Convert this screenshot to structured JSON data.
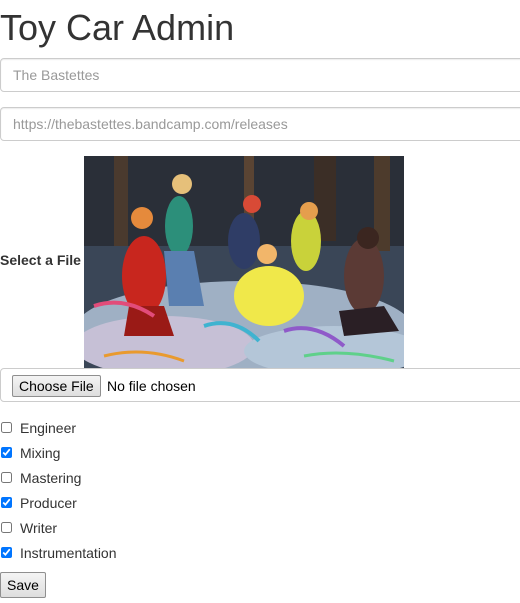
{
  "header": {
    "title": "Toy Car Admin"
  },
  "form": {
    "band_placeholder": "The Bastettes",
    "url_placeholder": "https://thebastettes.bandcamp.com/releases",
    "file_label": "Select a File",
    "choose_file_label": "Choose File",
    "no_file_text": "No file chosen",
    "roles": [
      {
        "label": "Engineer",
        "checked": false
      },
      {
        "label": "Mixing",
        "checked": true
      },
      {
        "label": "Mastering",
        "checked": false
      },
      {
        "label": "Producer",
        "checked": true
      },
      {
        "label": "Writer",
        "checked": false
      },
      {
        "label": "Instrumentation",
        "checked": true
      }
    ],
    "save_label": "Save"
  }
}
